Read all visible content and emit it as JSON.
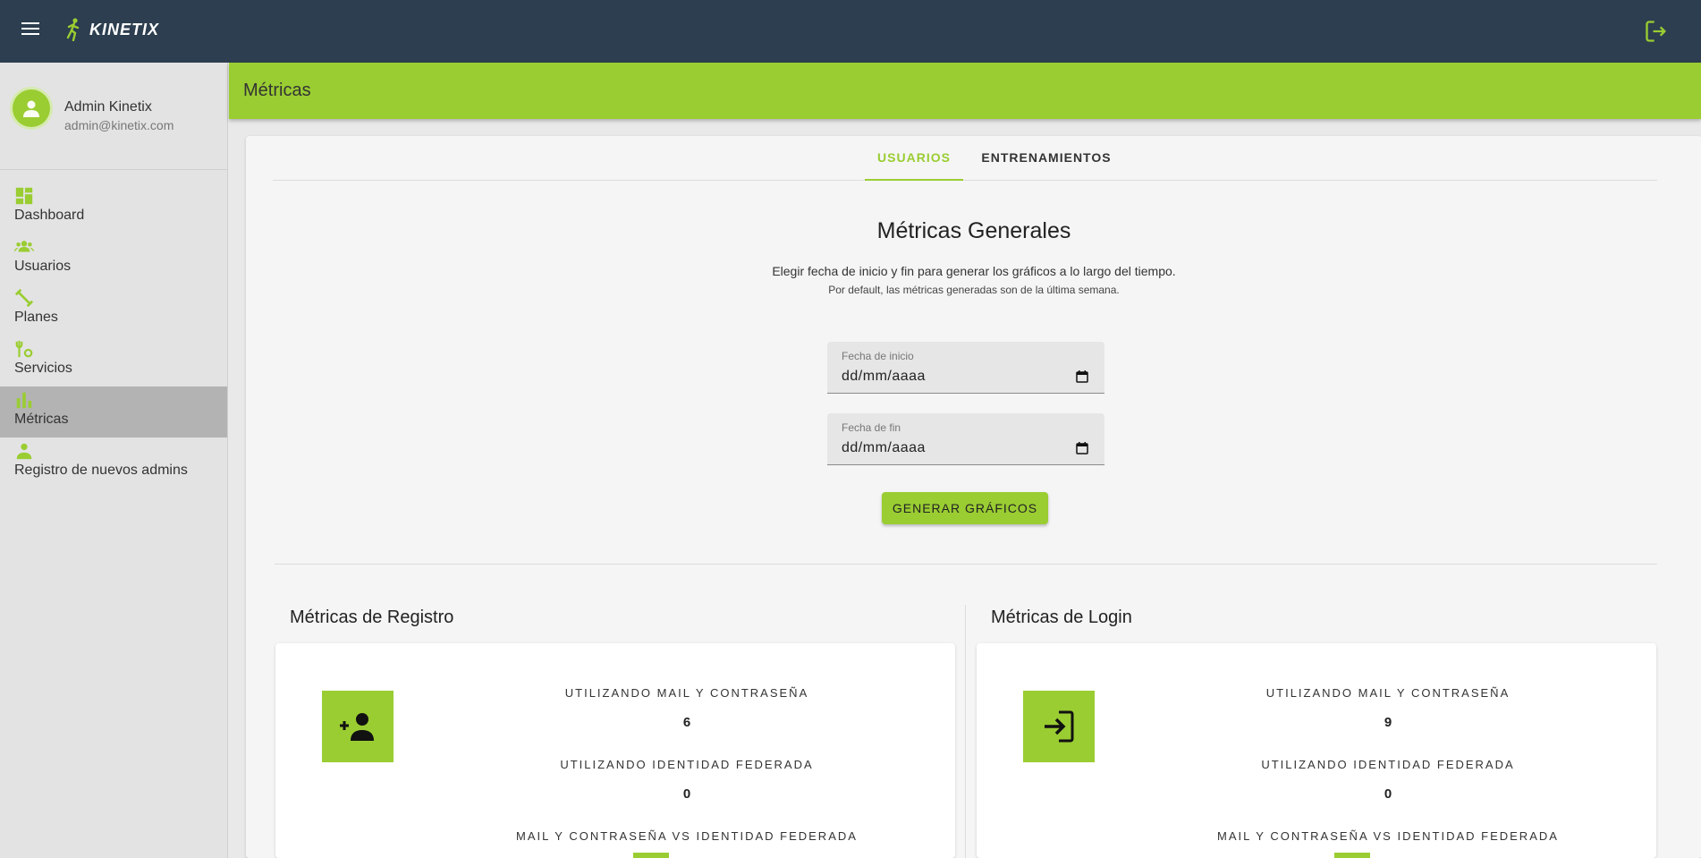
{
  "app": {
    "name": "KINETIX"
  },
  "profile": {
    "name": "Admin Kinetix",
    "email": "admin@kinetix.com"
  },
  "sidebar": {
    "items": [
      {
        "label": "Dashboard",
        "icon": "dashboard-icon"
      },
      {
        "label": "Usuarios",
        "icon": "users-icon"
      },
      {
        "label": "Planes",
        "icon": "plans-icon"
      },
      {
        "label": "Servicios",
        "icon": "services-icon"
      },
      {
        "label": "Métricas",
        "icon": "metrics-icon",
        "active": true
      },
      {
        "label": "Registro de nuevos admins",
        "icon": "admin-register-icon"
      }
    ]
  },
  "header": {
    "title": "Métricas"
  },
  "tabs": [
    {
      "label": "USUARIOS",
      "active": true
    },
    {
      "label": "ENTRENAMIENTOS",
      "active": false
    }
  ],
  "general": {
    "title": "Métricas Generales",
    "desc1": "Elegir fecha de inicio y fin para generar los gráficos a lo largo del tiempo.",
    "desc2": "Por default, las métricas generadas son de la última semana."
  },
  "form": {
    "start_label": "Fecha de inicio",
    "start_value": "dd/mm/aaaa",
    "end_label": "Fecha de fin",
    "end_value": "dd/mm/aaaa",
    "button_label": "GENERAR GRÁFICOS"
  },
  "registro": {
    "title": "Métricas de Registro",
    "mail_label": "UTILIZANDO MAIL Y CONTRASEÑA",
    "mail_value": "6",
    "fed_label": "UTILIZANDO IDENTIDAD FEDERADA",
    "fed_value": "0",
    "vs_label": "MAIL Y CONTRASEÑA VS IDENTIDAD FEDERADA"
  },
  "login": {
    "title": "Métricas de Login",
    "mail_label": "UTILIZANDO MAIL Y CONTRASEÑA",
    "mail_value": "9",
    "fed_label": "UTILIZANDO IDENTIDAD FEDERADA",
    "fed_value": "0",
    "vs_label": "MAIL Y CONTRASEÑA VS IDENTIDAD FEDERADA"
  },
  "colors": {
    "topbar": "#2c3e4f",
    "accent": "#9acd32",
    "sidebar": "#e3e3e3",
    "active_item": "#b3b3b3"
  }
}
